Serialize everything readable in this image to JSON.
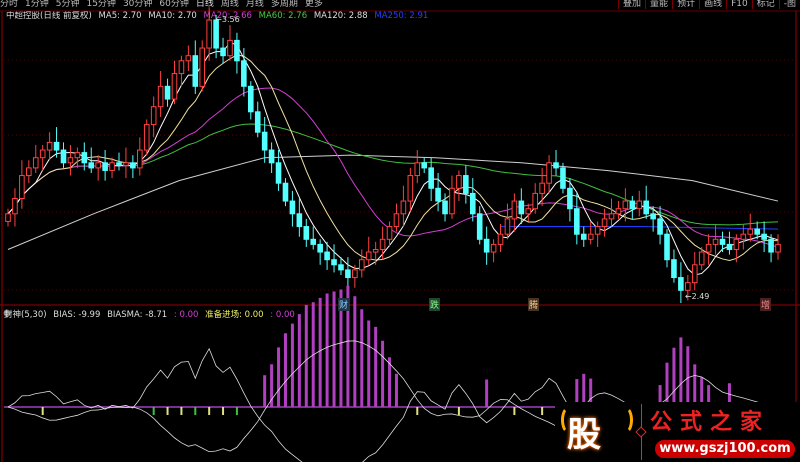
{
  "menu": {
    "items": [
      "分时",
      "1分钟",
      "5分钟",
      "15分钟",
      "30分钟",
      "60分钟",
      "日线",
      "周线",
      "月线",
      "多周期",
      "更多"
    ],
    "active": "日线",
    "right_items": [
      "叠加",
      "量能",
      "预计",
      "画线",
      "F10",
      "标记",
      "-图"
    ]
  },
  "header": {
    "title": "中超控股(日线 前复权)",
    "ma5": "MA5: 2.70",
    "ma10": "MA10: 2.70",
    "ma20": "MA20: 2.66",
    "ma60": "MA60: 2.76",
    "ma120": "MA120: 2.88",
    "ma250": "MA250: 2.91"
  },
  "annotations": {
    "high": "3.56",
    "low": "2.49"
  },
  "markers": [
    "财",
    "跌",
    "腾",
    "增"
  ],
  "indicator": {
    "name": "封神(5,30)",
    "bias": "BIAS: -9.99",
    "biasma": "BIASMA: -8.71",
    "v1": ": 0.00",
    "entry": "准备进场: 0.00",
    "v2": ": 0.00"
  },
  "logo": {
    "char": "股",
    "title": "公式之家",
    "url": "www.gszj100.com"
  },
  "colors": {
    "up": "#ff4040",
    "down": "#54ffff",
    "ma5": "#ffffff",
    "ma10": "#f0e0a0",
    "ma20": "#d040d0",
    "ma60": "#40c040",
    "ma120": "#d0d0d0",
    "ma250": "#2040ff",
    "bars": "#b040c0"
  },
  "chart_data": {
    "type": "candlestick",
    "price_range": [
      2.4,
      3.6
    ],
    "close": [
      2.8,
      2.86,
      2.95,
      2.98,
      3.02,
      3.05,
      3.08,
      3.05,
      3.0,
      3.02,
      3.04,
      3.0,
      2.98,
      3.0,
      2.97,
      3.0,
      2.99,
      3.0,
      2.98,
      3.05,
      3.15,
      3.22,
      3.3,
      3.25,
      3.35,
      3.4,
      3.42,
      3.3,
      3.45,
      3.56,
      3.45,
      3.42,
      3.48,
      3.4,
      3.3,
      3.2,
      3.12,
      3.05,
      3.0,
      2.92,
      2.85,
      2.8,
      2.75,
      2.7,
      2.68,
      2.65,
      2.62,
      2.6,
      2.58,
      2.55,
      2.58,
      2.62,
      2.65,
      2.66,
      2.7,
      2.75,
      2.8,
      2.85,
      2.95,
      3.0,
      2.98,
      2.9,
      2.85,
      2.8,
      2.9,
      2.95,
      2.88,
      2.8,
      2.7,
      2.65,
      2.68,
      2.72,
      2.78,
      2.85,
      2.8,
      2.82,
      2.88,
      2.92,
      3.0,
      2.98,
      2.9,
      2.82,
      2.72,
      2.7,
      2.72,
      2.75,
      2.78,
      2.8,
      2.82,
      2.85,
      2.82,
      2.85,
      2.8,
      2.78,
      2.72,
      2.62,
      2.55,
      2.5,
      2.53,
      2.6,
      2.65,
      2.68,
      2.7,
      2.68,
      2.66,
      2.7,
      2.72,
      2.74,
      2.72,
      2.7,
      2.65,
      2.68
    ],
    "ma120": [
      2.66,
      2.8,
      2.93,
      3.02,
      3.03,
      3.02,
      3.0,
      2.97,
      2.93,
      2.85
    ],
    "ma250": [
      2.75,
      2.75,
      2.74
    ]
  }
}
